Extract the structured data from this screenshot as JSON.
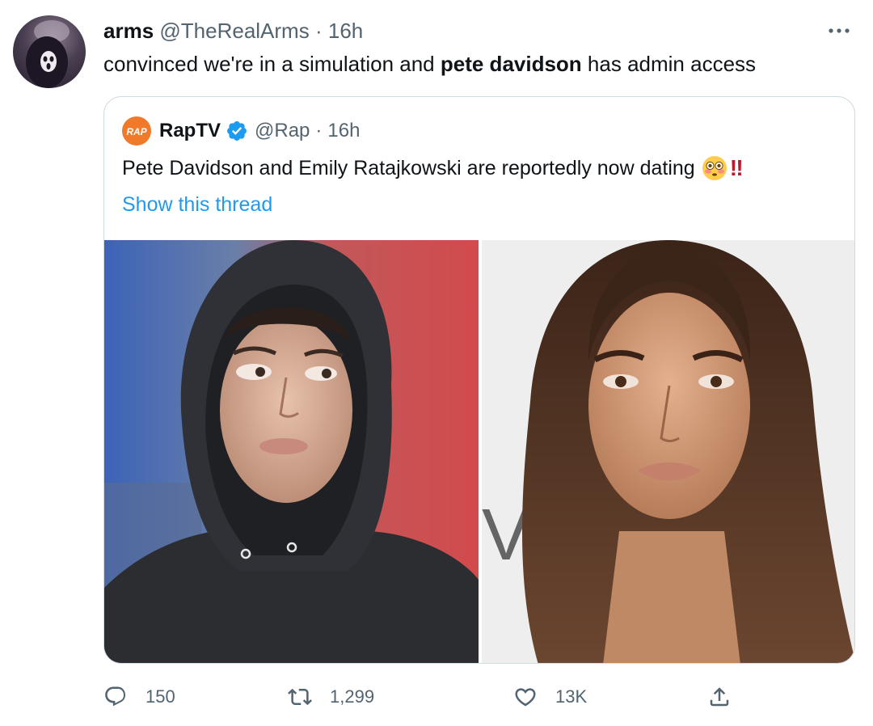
{
  "author": {
    "name": "arms",
    "handle": "@TheRealArms",
    "separator": "·",
    "time": "16h"
  },
  "tweet": {
    "text_before": "convinced we're in a simulation and ",
    "text_bold": "pete davidson",
    "text_after": " has admin access"
  },
  "quoted": {
    "avatar_label": "RAP",
    "name": "RapTV",
    "handle": "@Rap",
    "separator": "·",
    "time": "16h",
    "text": "Pete Davidson and Emily Ratajkowski are reportedly now dating",
    "emoji": "flushed-face",
    "bangbang": "‼",
    "show_thread": "Show this thread",
    "photos": [
      "photo-left",
      "photo-right"
    ],
    "photo_right_backdrop_text": "VE"
  },
  "actions": {
    "replies": "150",
    "retweets": "1,299",
    "likes": "13K"
  },
  "colors": {
    "link": "#1d9bf0",
    "muted": "#536471",
    "border": "#cfd9de",
    "brand_rap": "#f07a2a",
    "verified": "#1d9bf0"
  }
}
